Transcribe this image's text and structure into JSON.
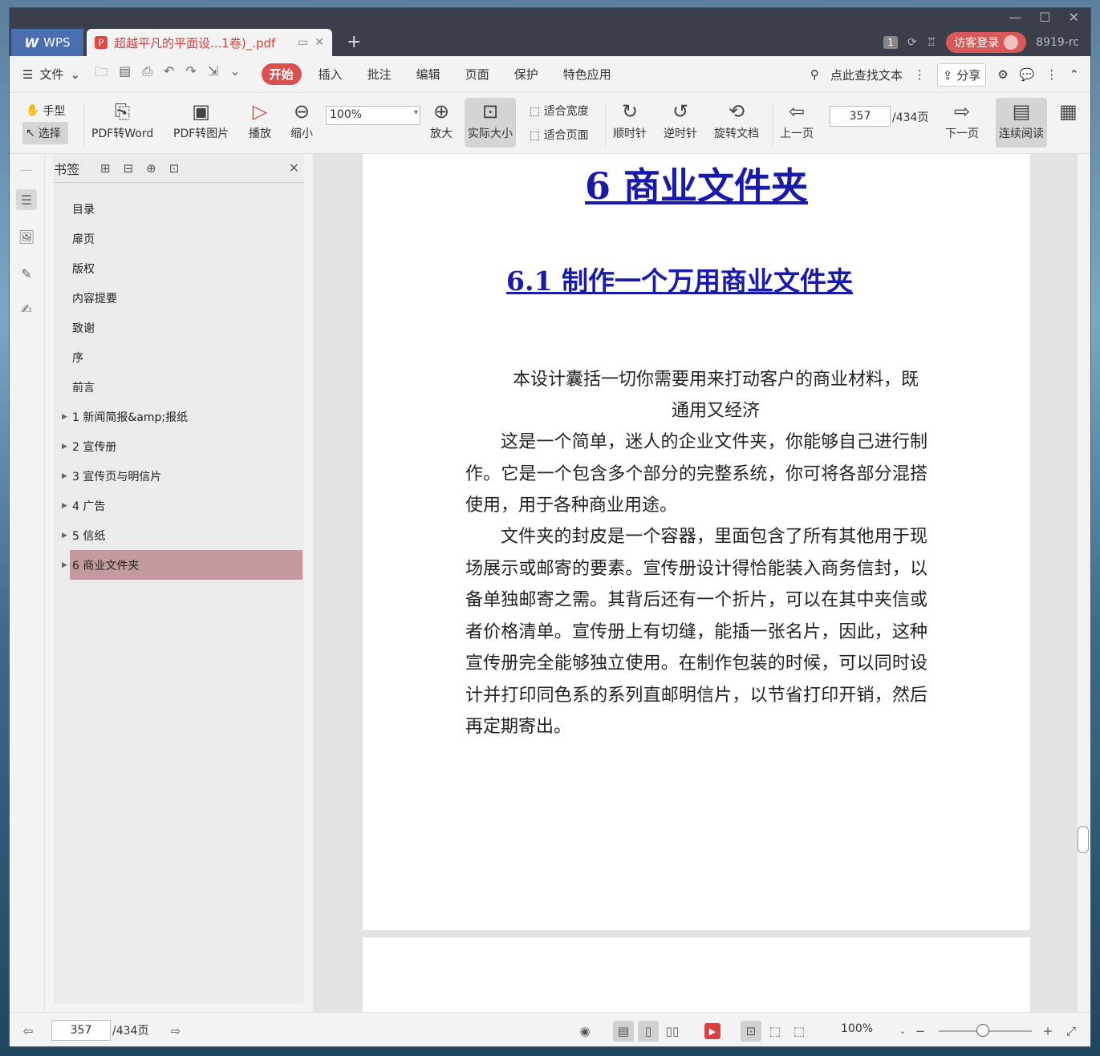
{
  "titlebar": {
    "app_name": "WPS",
    "doc_tab": "超越平凡的平面设...1卷)_.pdf",
    "page_badge": "1",
    "login_label": "访客登录",
    "user_id": "8919-rc"
  },
  "menubar": {
    "file_label": "文件",
    "items": [
      "开始",
      "插入",
      "批注",
      "编辑",
      "页面",
      "保护",
      "特色应用"
    ],
    "search_label": "点此查找文本",
    "share_label": "分享"
  },
  "toolbar": {
    "hand_label": "手型",
    "select_label": "选择",
    "pdf_to_word": "PDF转Word",
    "pdf_to_image": "PDF转图片",
    "play": "播放",
    "zoom_out": "缩小",
    "zoom_value": "100%",
    "zoom_in": "放大",
    "actual_size": "实际大小",
    "fit_width": "适合宽度",
    "fit_page": "适合页面",
    "clockwise": "顺时针",
    "counterclockwise": "逆时针",
    "rotate_doc": "旋转文档",
    "prev_page": "上一页",
    "current_page": "357",
    "total_pages": "/434页",
    "next_page": "下一页",
    "continuous_read": "连续阅读"
  },
  "bookmark": {
    "title": "书签",
    "items": [
      {
        "label": "目录"
      },
      {
        "label": "扉页"
      },
      {
        "label": "版权"
      },
      {
        "label": "内容提要"
      },
      {
        "label": "致谢"
      },
      {
        "label": "序"
      },
      {
        "label": "前言"
      },
      {
        "label": "1 新闻简报&amp;报纸"
      },
      {
        "label": "2 宣传册"
      },
      {
        "label": "3 宣传页与明信片"
      },
      {
        "label": "4 广告"
      },
      {
        "label": "5 信纸"
      },
      {
        "label": "6 商业文件夹"
      }
    ]
  },
  "document": {
    "heading1": "6 商业文件夹",
    "heading2": "6.1 制作一个万用商业文件夹",
    "subtitle": "本设计囊括一切你需要用来打动客户的商业材料，既通用又经济",
    "para1": "这是一个简单，迷人的企业文件夹，你能够自己进行制作。它是一个包含多个部分的完整系统，你可将各部分混搭使用，用于各种商业用途。",
    "para2": "文件夹的封皮是一个容器，里面包含了所有其他用于现场展示或邮寄的要素。宣传册设计得恰能装入商务信封，以备单独邮寄之需。其背后还有一个折片，可以在其中夹信或者价格清单。宣传册上有切缝，能插一张名片，因此，这种宣传册完全能够独立使用。在制作包装的时候，可以同时设计并打印同色系的系列直邮明信片，以节省打印开销，然后再定期寄出。"
  },
  "statusbar": {
    "current_page": "357",
    "total_pages": "/434页",
    "zoom_value": "100%"
  }
}
